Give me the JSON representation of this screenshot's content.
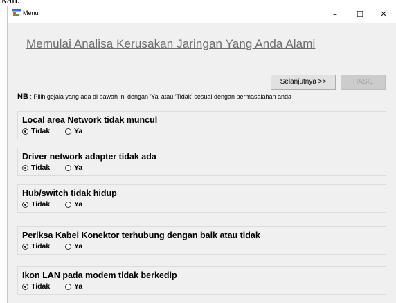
{
  "window": {
    "title": "Menu",
    "minimize": "–",
    "maximize": "☐",
    "close": "✕"
  },
  "top_strip_text": "kan.",
  "heading": "Memulai Analisa Kerusakan Jaringan Yang Anda Alami",
  "buttons": {
    "next": "Selanjutnya >>",
    "hasil": "HASIL"
  },
  "note": {
    "label": "NB",
    "text": " : Pilih gejala yang ada di bawah ini dengan 'Ya' atau 'Tidak' sesuai dengan permasalahan anda"
  },
  "questions": [
    {
      "text": "Local area Network tidak muncul",
      "option_tidak": "Tidak",
      "option_ya": "Ya",
      "selected": "Tidak"
    },
    {
      "text": "Driver network adapter tidak ada",
      "option_tidak": "Tidak",
      "option_ya": "Ya",
      "selected": "Tidak"
    },
    {
      "text": "Hub/switch tidak hidup",
      "option_tidak": "Tidak",
      "option_ya": "Ya",
      "selected": "Tidak"
    },
    {
      "text": "Periksa Kabel Konektor terhubung dengan baik atau tidak",
      "option_tidak": "Tidak",
      "option_ya": "Ya",
      "selected": "Tidak"
    },
    {
      "text": "Ikon LAN pada modem tidak berkedip",
      "option_tidak": "Tidak",
      "option_ya": "Ya",
      "selected": "Tidak"
    }
  ]
}
